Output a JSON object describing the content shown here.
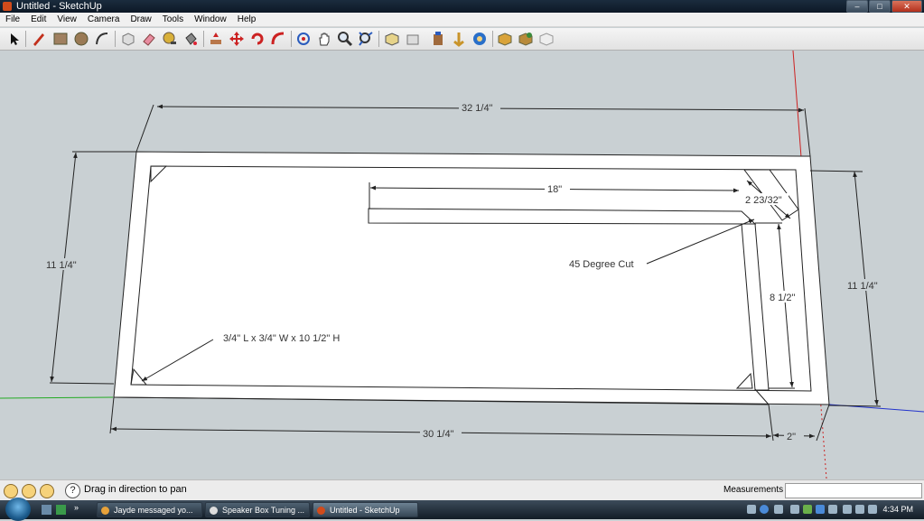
{
  "window": {
    "title": "Untitled - SketchUp",
    "controls": [
      "minimize",
      "maximize",
      "close"
    ]
  },
  "menubar": {
    "items": [
      "File",
      "Edit",
      "View",
      "Camera",
      "Draw",
      "Tools",
      "Window",
      "Help"
    ]
  },
  "toolbar": {
    "tools": [
      "select-icon",
      "pencil-icon",
      "rectangle-icon",
      "circle-icon",
      "arc-icon",
      "make-component-icon",
      "eraser-icon",
      "tape-measure-icon",
      "paint-bucket-icon",
      "push-pull-icon",
      "move-icon",
      "rotate-icon",
      "follow-me-icon",
      "orbit-icon",
      "pan-icon",
      "zoom-icon",
      "zoom-extents-icon",
      "iso-view-icon",
      "top-view-icon",
      "front-view-icon",
      "right-view-icon",
      "back-view-icon",
      "get-models-icon",
      "share-model-icon",
      "share-component-icon"
    ]
  },
  "drawing": {
    "dimensions": {
      "top_width": "32 1/4\"",
      "inner_bar": "18\"",
      "diagonal": "2 23/32\"",
      "left_height": "11 1/4\"",
      "right_height": "11 1/4\"",
      "inner_height": "8 1/2\"",
      "bottom_width": "30 1/4\"",
      "gap_width": "2\""
    },
    "annotations": {
      "cut_note": "45 Degree Cut",
      "block_note": "3/4\" L x 3/4\" W x 10 1/2\" H"
    },
    "colors": {
      "background": "#c9d0d3",
      "face": "#ffffff",
      "edge": "#222222",
      "red_axis": "#cc2222",
      "green_axis": "#22aa22",
      "blue_axis": "#2233cc"
    }
  },
  "statusbar": {
    "hint": "Drag in direction to pan",
    "measurements_label": "Measurements",
    "measurements_value": ""
  },
  "taskbar": {
    "tasks": [
      {
        "label": "Jayde messaged yo...",
        "active": false
      },
      {
        "label": "Speaker Box Tuning ...",
        "active": false
      },
      {
        "label": "Untitled - SketchUp",
        "active": true
      }
    ],
    "clock": "4:34 PM"
  }
}
